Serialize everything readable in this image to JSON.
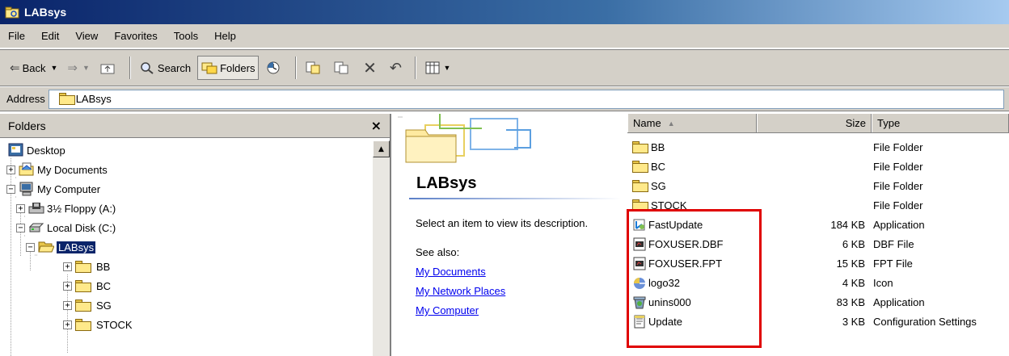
{
  "window": {
    "title": "LABsys"
  },
  "menu": [
    "File",
    "Edit",
    "View",
    "Favorites",
    "Tools",
    "Help"
  ],
  "toolbar": {
    "back_label": "Back",
    "search_label": "Search",
    "folders_label": "Folders"
  },
  "address": {
    "label": "Address",
    "value": "LABsys"
  },
  "folders_pane": {
    "header": "Folders",
    "close_glyph": "×",
    "tree": [
      {
        "label": "Desktop",
        "icon": "desktop-icon"
      },
      {
        "label": "My Documents",
        "icon": "my-documents-icon",
        "expander": "+"
      },
      {
        "label": "My Computer",
        "icon": "my-computer-icon",
        "expander": "−"
      },
      {
        "label": "3½ Floppy (A:)",
        "icon": "floppy-icon",
        "expander": "+"
      },
      {
        "label": "Local Disk (C:)",
        "icon": "local-disk-icon",
        "expander": "−"
      },
      {
        "label": "LABsys",
        "icon": "folder-open-icon",
        "expander": "−",
        "selected": true
      },
      {
        "label": "BB",
        "icon": "folder-icon",
        "expander": "+"
      },
      {
        "label": "BC",
        "icon": "folder-icon",
        "expander": "+"
      },
      {
        "label": "SG",
        "icon": "folder-icon",
        "expander": "+"
      },
      {
        "label": "STOCK",
        "icon": "folder-icon",
        "expander": "+"
      }
    ]
  },
  "webview": {
    "title": "LABsys",
    "description": "Select an item to view its description.",
    "see_also": "See also:",
    "links": [
      "My Documents",
      "My Network Places",
      "My Computer"
    ]
  },
  "listview": {
    "columns": {
      "name": "Name",
      "size": "Size",
      "type": "Type"
    },
    "sort_indicator": "▲",
    "rows": [
      {
        "name": "BB",
        "size": "",
        "type": "File Folder",
        "icon": "folder-icon"
      },
      {
        "name": "BC",
        "size": "",
        "type": "File Folder",
        "icon": "folder-icon"
      },
      {
        "name": "SG",
        "size": "",
        "type": "File Folder",
        "icon": "folder-icon"
      },
      {
        "name": "STOCK",
        "size": "",
        "type": "File Folder",
        "icon": "folder-icon"
      },
      {
        "name": "FastUpdate",
        "size": "184 KB",
        "type": "Application",
        "icon": "installer-icon"
      },
      {
        "name": "FOXUSER.DBF",
        "size": "6 KB",
        "type": "DBF File",
        "icon": "foxpro-file-icon"
      },
      {
        "name": "FOXUSER.FPT",
        "size": "15 KB",
        "type": "FPT File",
        "icon": "foxpro-file-icon"
      },
      {
        "name": "logo32",
        "size": "4 KB",
        "type": "Icon",
        "icon": "logo-icon"
      },
      {
        "name": "unins000",
        "size": "83 KB",
        "type": "Application",
        "icon": "uninstaller-icon"
      },
      {
        "name": "Update",
        "size": "3 KB",
        "type": "Configuration Settings",
        "icon": "config-file-icon"
      }
    ]
  },
  "colors": {
    "titlebar_start": "#0a246a",
    "chrome": "#d4d0c8",
    "selection": "#0a246a",
    "highlight_border": "#e00000",
    "link": "#0000ee"
  }
}
